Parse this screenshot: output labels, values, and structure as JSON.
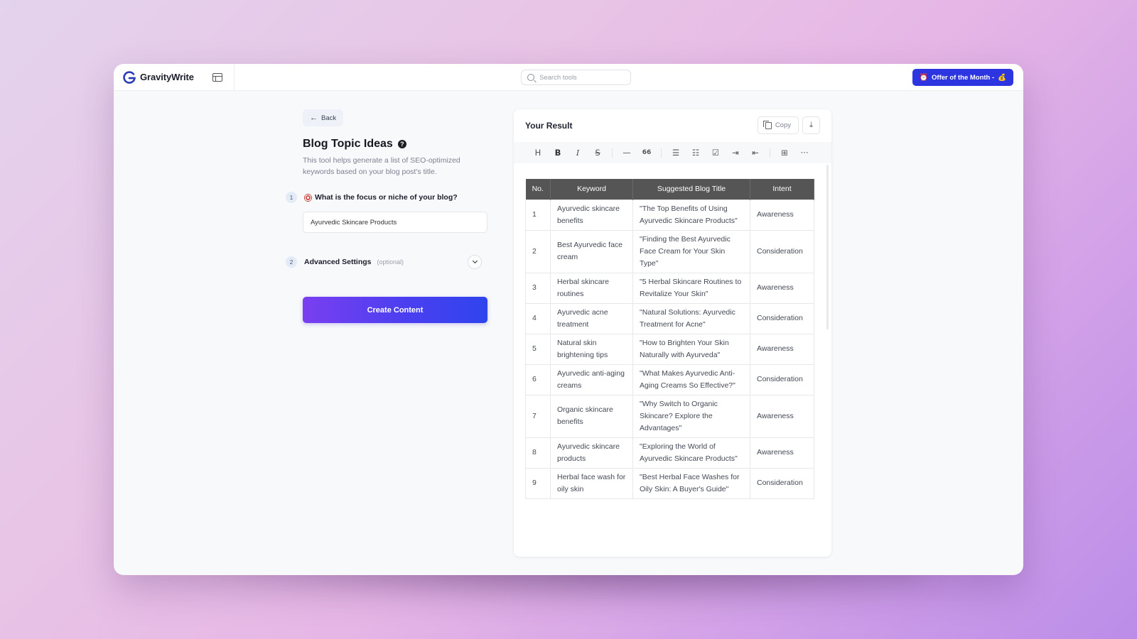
{
  "app": {
    "brand_name": "GravityWrite",
    "accent_color": "#2d35e0"
  },
  "topbar": {
    "search_placeholder": "Search tools",
    "offer_label": "Offer of the Month -",
    "offer_icon": "alarm-clock",
    "offer_trailing_icon": "money-bag"
  },
  "left_panel": {
    "back_label": "Back",
    "title": "Blog Topic Ideas",
    "help_icon": "?",
    "description": "This tool helps generate a list of SEO-optimized keywords based on your blog post's title.",
    "steps": [
      {
        "number": "1",
        "label": "What is the focus or niche of your blog?",
        "icon": "target-icon",
        "value": "Ayurvedic Skincare Products"
      },
      {
        "number": "2",
        "label": "Advanced Settings",
        "optional": "(optional)"
      }
    ],
    "create_label": "Create Content"
  },
  "result": {
    "title": "Your Result",
    "copy_label": "Copy",
    "download_icon": "⤓",
    "toolbar": {
      "heading": "H",
      "bold": "B",
      "italic": "I",
      "strike": "S",
      "hr": "—",
      "quote": "66",
      "bullet": "☰",
      "ordered": "☷",
      "task": "☑",
      "indent": "⇥",
      "outdent": "⇤",
      "table": "⊞",
      "more": "···"
    },
    "table": {
      "headers": [
        "No.",
        "Keyword",
        "Suggested Blog Title",
        "Intent"
      ],
      "rows": [
        {
          "no": "1",
          "keyword": "Ayurvedic skincare benefits",
          "title": "\"The Top Benefits of Using Ayurvedic Skincare Products\"",
          "intent": "Awareness"
        },
        {
          "no": "2",
          "keyword": "Best Ayurvedic face cream",
          "title": "\"Finding the Best Ayurvedic Face Cream for Your Skin Type\"",
          "intent": "Consideration"
        },
        {
          "no": "3",
          "keyword": "Herbal skincare routines",
          "title": "\"5 Herbal Skincare Routines to Revitalize Your Skin\"",
          "intent": "Awareness"
        },
        {
          "no": "4",
          "keyword": "Ayurvedic acne treatment",
          "title": "\"Natural Solutions: Ayurvedic Treatment for Acne\"",
          "intent": "Consideration"
        },
        {
          "no": "5",
          "keyword": "Natural skin brightening tips",
          "title": "\"How to Brighten Your Skin Naturally with Ayurveda\"",
          "intent": "Awareness"
        },
        {
          "no": "6",
          "keyword": "Ayurvedic anti-aging creams",
          "title": "\"What Makes Ayurvedic Anti-Aging Creams So Effective?\"",
          "intent": "Consideration"
        },
        {
          "no": "7",
          "keyword": "Organic skincare benefits",
          "title": "\"Why Switch to Organic Skincare? Explore the Advantages\"",
          "intent": "Awareness"
        },
        {
          "no": "8",
          "keyword": "Ayurvedic skincare products",
          "title": "\"Exploring the World of Ayurvedic Skincare Products\"",
          "intent": "Awareness"
        },
        {
          "no": "9",
          "keyword": "Herbal face wash for oily skin",
          "title": "\"Best Herbal Face Washes for Oily Skin: A Buyer's Guide\"",
          "intent": "Consideration"
        }
      ]
    }
  }
}
